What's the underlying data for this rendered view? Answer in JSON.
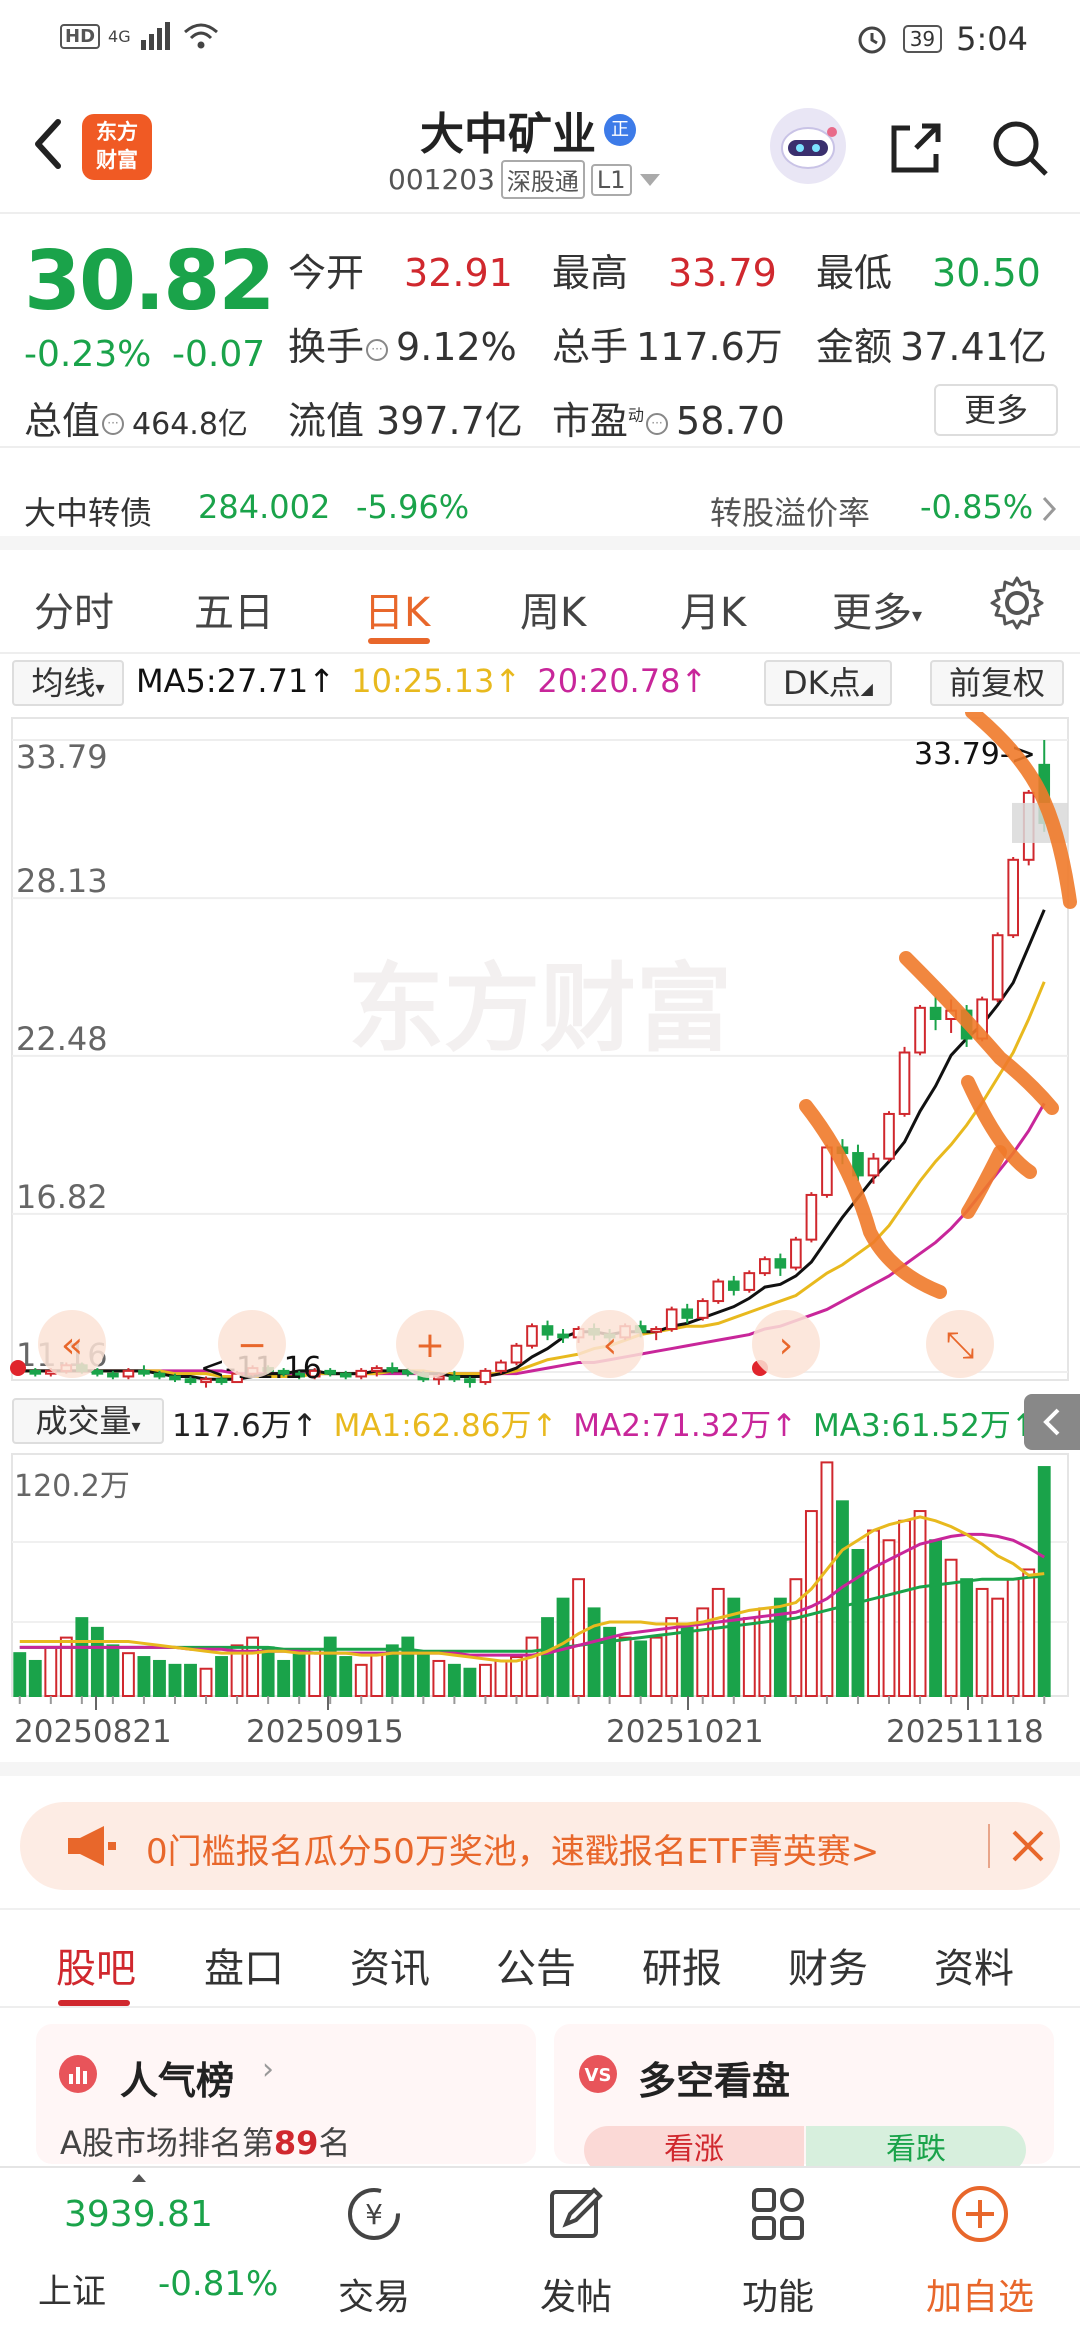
{
  "status": {
    "network": "4G",
    "hd": "HD",
    "battery": "39",
    "time": "5:04"
  },
  "header": {
    "logo_line1": "东方",
    "logo_line2": "财富",
    "stock_name": "大中矿业",
    "badge": "正",
    "code": "001203",
    "tag1": "深股通",
    "tag2": "L1"
  },
  "quote": {
    "price": "30.82",
    "change_pct": "-0.23%",
    "change": "-0.07",
    "open_label": "今开",
    "open": "32.91",
    "high_label": "最高",
    "high": "33.79",
    "low_label": "最低",
    "low": "30.50",
    "turnover_label": "换手",
    "turnover": "9.12%",
    "volume_label": "总手",
    "volume": "117.6万",
    "amount_label": "金额",
    "amount": "37.41亿",
    "mktcap_label": "总值",
    "mktcap": "464.8亿",
    "float_label": "流值",
    "float": "397.7亿",
    "pe_label": "市盈",
    "pe_sup": "动",
    "pe": "58.70",
    "more": "更多"
  },
  "bond": {
    "name": "大中转债",
    "price": "284.002",
    "pct": "-5.96%",
    "premium_label": "转股溢价率",
    "premium": "-0.85%"
  },
  "ktabs": [
    "分时",
    "五日",
    "日K",
    "周K",
    "月K",
    "更多"
  ],
  "ktabs_active": "日K",
  "chart_header": {
    "ma_btn": "均线",
    "ma5": "MA5:27.71↑",
    "ma10": "10:25.13↑",
    "ma20": "20:20.78↑",
    "dk_btn": "DK点",
    "fq_btn": "前复权"
  },
  "chart_data": {
    "type": "candlestick",
    "y_ticks": [
      "33.79",
      "28.13",
      "22.48",
      "16.82",
      "11.16"
    ],
    "ylim": [
      11.16,
      33.79
    ],
    "high_marker": "33.79->",
    "low_marker": "<-11.16",
    "watermark": "东方财富",
    "x_ticks": [
      "20250821",
      "20250915",
      "20251021",
      "20251118"
    ],
    "candles": [
      [
        11.3,
        11.4,
        11.1,
        11.2
      ],
      [
        11.2,
        11.3,
        11.0,
        11.1
      ],
      [
        11.1,
        11.3,
        11.0,
        11.2
      ],
      [
        11.2,
        11.5,
        11.1,
        11.4
      ],
      [
        11.4,
        11.5,
        11.1,
        11.2
      ],
      [
        11.2,
        11.3,
        11.0,
        11.1
      ],
      [
        11.1,
        11.2,
        10.9,
        11.0
      ],
      [
        11.0,
        11.3,
        10.9,
        11.2
      ],
      [
        11.2,
        11.4,
        11.0,
        11.1
      ],
      [
        11.1,
        11.2,
        10.9,
        11.0
      ],
      [
        11.0,
        11.1,
        10.8,
        10.9
      ],
      [
        10.9,
        11.0,
        10.7,
        10.8
      ],
      [
        10.8,
        11.0,
        10.6,
        10.9
      ],
      [
        10.9,
        11.0,
        10.7,
        10.8
      ],
      [
        10.8,
        11.2,
        10.8,
        11.1
      ],
      [
        11.1,
        11.4,
        11.0,
        11.3
      ],
      [
        11.3,
        11.4,
        11.1,
        11.2
      ],
      [
        11.2,
        11.3,
        11.0,
        11.1
      ],
      [
        11.1,
        11.2,
        10.9,
        11.0
      ],
      [
        11.0,
        11.3,
        10.9,
        11.2
      ],
      [
        11.2,
        11.3,
        11.0,
        11.1
      ],
      [
        11.1,
        11.2,
        10.9,
        11.0
      ],
      [
        11.0,
        11.3,
        10.9,
        11.2
      ],
      [
        11.2,
        11.4,
        11.0,
        11.3
      ],
      [
        11.3,
        11.5,
        11.1,
        11.2
      ],
      [
        11.2,
        11.3,
        11.0,
        11.1
      ],
      [
        11.1,
        11.2,
        10.8,
        10.9
      ],
      [
        10.9,
        11.1,
        10.7,
        11.0
      ],
      [
        11.0,
        11.2,
        10.8,
        10.9
      ],
      [
        10.9,
        11.0,
        10.6,
        10.8
      ],
      [
        10.8,
        11.3,
        10.7,
        11.2
      ],
      [
        11.2,
        11.6,
        11.1,
        11.5
      ],
      [
        11.5,
        12.2,
        11.4,
        12.1
      ],
      [
        12.1,
        12.9,
        12.0,
        12.8
      ],
      [
        12.8,
        13.0,
        12.3,
        12.5
      ],
      [
        12.5,
        12.7,
        12.2,
        12.4
      ],
      [
        12.4,
        12.8,
        12.2,
        12.7
      ],
      [
        12.7,
        12.9,
        12.3,
        12.5
      ],
      [
        12.5,
        12.7,
        12.2,
        12.4
      ],
      [
        12.4,
        12.9,
        12.3,
        12.8
      ],
      [
        12.8,
        13.0,
        12.4,
        12.6
      ],
      [
        12.6,
        12.8,
        12.3,
        12.7
      ],
      [
        12.7,
        13.5,
        12.6,
        13.4
      ],
      [
        13.4,
        13.6,
        12.9,
        13.1
      ],
      [
        13.1,
        13.8,
        13.0,
        13.7
      ],
      [
        13.7,
        14.5,
        13.6,
        14.4
      ],
      [
        14.4,
        14.6,
        13.9,
        14.1
      ],
      [
        14.1,
        14.8,
        14.0,
        14.7
      ],
      [
        14.7,
        15.3,
        14.6,
        15.2
      ],
      [
        15.2,
        15.4,
        14.6,
        14.9
      ],
      [
        14.9,
        16.0,
        14.8,
        15.9
      ],
      [
        15.9,
        17.6,
        15.8,
        17.5
      ],
      [
        17.5,
        19.3,
        17.4,
        19.2
      ],
      [
        19.2,
        19.5,
        18.6,
        19.0
      ],
      [
        19.0,
        19.3,
        18.0,
        18.2
      ],
      [
        18.2,
        19.0,
        17.9,
        18.8
      ],
      [
        18.8,
        20.5,
        18.7,
        20.4
      ],
      [
        20.4,
        22.8,
        20.3,
        22.6
      ],
      [
        22.6,
        24.3,
        22.5,
        24.2
      ],
      [
        24.2,
        24.6,
        23.4,
        23.8
      ],
      [
        23.8,
        24.5,
        23.3,
        24.1
      ],
      [
        24.1,
        24.3,
        22.8,
        23.1
      ],
      [
        23.1,
        24.6,
        23.0,
        24.5
      ],
      [
        24.5,
        26.9,
        24.4,
        26.8
      ],
      [
        26.8,
        29.6,
        26.7,
        29.5
      ],
      [
        29.5,
        32.0,
        29.3,
        31.9
      ],
      [
        32.9,
        33.79,
        30.5,
        30.82
      ]
    ],
    "ma5": [
      11.2,
      11.2,
      11.2,
      11.2,
      11.2,
      11.2,
      11.2,
      11.2,
      11.2,
      11.1,
      11.0,
      11.0,
      10.9,
      10.9,
      10.9,
      11.0,
      11.1,
      11.1,
      11.2,
      11.2,
      11.1,
      11.1,
      11.1,
      11.2,
      11.2,
      11.2,
      11.1,
      11.1,
      11.0,
      11.0,
      11.0,
      11.1,
      11.3,
      11.7,
      12.0,
      12.4,
      12.6,
      12.6,
      12.5,
      12.6,
      12.6,
      12.6,
      12.8,
      12.9,
      13.1,
      13.3,
      13.5,
      13.8,
      14.2,
      14.3,
      14.6,
      15.1,
      15.9,
      16.7,
      17.4,
      18.1,
      18.7,
      19.4,
      20.5,
      21.4,
      22.5,
      23.1,
      23.6,
      24.3,
      25.1,
      26.4,
      27.71
    ],
    "ma10": [
      11.2,
      11.2,
      11.2,
      11.2,
      11.2,
      11.2,
      11.2,
      11.2,
      11.2,
      11.2,
      11.1,
      11.1,
      11.1,
      11.0,
      11.0,
      11.0,
      11.0,
      11.0,
      11.0,
      11.1,
      11.1,
      11.1,
      11.1,
      11.1,
      11.2,
      11.2,
      11.2,
      11.1,
      11.1,
      11.1,
      11.1,
      11.1,
      11.2,
      11.4,
      11.6,
      11.7,
      11.8,
      12.0,
      12.1,
      12.3,
      12.5,
      12.6,
      12.7,
      12.8,
      12.8,
      12.9,
      13.1,
      13.3,
      13.5,
      13.7,
      13.9,
      14.3,
      14.7,
      15.0,
      15.4,
      15.8,
      16.4,
      17.2,
      18.0,
      18.7,
      19.3,
      20.0,
      20.8,
      21.7,
      22.6,
      23.8,
      25.13
    ],
    "ma20": [
      11.2,
      11.2,
      11.2,
      11.2,
      11.2,
      11.2,
      11.2,
      11.2,
      11.2,
      11.2,
      11.2,
      11.2,
      11.2,
      11.2,
      11.1,
      11.1,
      11.1,
      11.1,
      11.1,
      11.1,
      11.1,
      11.1,
      11.1,
      11.1,
      11.1,
      11.1,
      11.1,
      11.1,
      11.1,
      11.1,
      11.1,
      11.1,
      11.1,
      11.2,
      11.3,
      11.4,
      11.5,
      11.5,
      11.6,
      11.7,
      11.8,
      11.9,
      12.0,
      12.1,
      12.2,
      12.3,
      12.4,
      12.5,
      12.7,
      12.8,
      13.0,
      13.2,
      13.4,
      13.7,
      14.0,
      14.3,
      14.6,
      15.0,
      15.4,
      15.8,
      16.3,
      16.9,
      17.6,
      18.3,
      19.0,
      19.8,
      20.78
    ]
  },
  "volume_header": {
    "btn": "成交量",
    "vol": "117.6万↑",
    "ma1": "MA1:62.86万↑",
    "ma2": "MA2:71.32万↑",
    "ma3": "MA3:61.52万↑"
  },
  "volume_data": {
    "y_tick": "120.2万",
    "values": [
      22,
      18,
      25,
      30,
      40,
      35,
      26,
      22,
      20,
      18,
      16,
      16,
      14,
      20,
      26,
      30,
      25,
      18,
      22,
      24,
      30,
      20,
      16,
      22,
      26,
      30,
      22,
      18,
      16,
      14,
      16,
      18,
      20,
      30,
      40,
      50,
      60,
      45,
      35,
      30,
      28,
      30,
      40,
      35,
      45,
      55,
      50,
      40,
      45,
      50,
      60,
      95,
      120,
      100,
      75,
      85,
      80,
      90,
      95,
      80,
      70,
      60,
      55,
      50,
      60,
      65,
      117.6
    ],
    "ma1": [
      28,
      28,
      28,
      28,
      28,
      28,
      28,
      28,
      27,
      26,
      25,
      24,
      23,
      22,
      22,
      22,
      23,
      23,
      22,
      22,
      22,
      22,
      21,
      21,
      22,
      22,
      22,
      22,
      21,
      20,
      19,
      18,
      18,
      20,
      23,
      27,
      32,
      36,
      38,
      38,
      38,
      37,
      37,
      37,
      38,
      40,
      42,
      44,
      45,
      46,
      48,
      55,
      65,
      75,
      80,
      85,
      88,
      90,
      92,
      90,
      87,
      83,
      78,
      72,
      68,
      62,
      62.86
    ],
    "ma2": [
      25,
      25,
      25,
      25,
      25,
      25,
      25,
      25,
      25,
      25,
      25,
      24,
      24,
      24,
      23,
      23,
      23,
      23,
      23,
      22,
      22,
      22,
      22,
      22,
      22,
      22,
      22,
      22,
      22,
      21,
      21,
      21,
      21,
      21,
      22,
      24,
      26,
      28,
      30,
      32,
      33,
      34,
      35,
      36,
      37,
      38,
      39,
      40,
      41,
      42,
      43,
      46,
      50,
      56,
      61,
      66,
      70,
      74,
      78,
      80,
      82,
      83,
      83,
      82,
      80,
      76,
      71.32
    ],
    "ma3": [
      25,
      25,
      25,
      25,
      25,
      25,
      25,
      25,
      25,
      25,
      25,
      25,
      25,
      25,
      25,
      25,
      25,
      24,
      24,
      24,
      24,
      24,
      24,
      24,
      24,
      24,
      23,
      23,
      23,
      23,
      23,
      23,
      23,
      23,
      24,
      25,
      26,
      27,
      28,
      29,
      30,
      31,
      32,
      33,
      34,
      35,
      36,
      37,
      38,
      39,
      40,
      42,
      44,
      46,
      48,
      50,
      52,
      54,
      56,
      57,
      58,
      59,
      60,
      60,
      60,
      61,
      61.52
    ]
  },
  "promo": "0门槛报名瓜分50万奖池，速戳报名ETF菁英赛>",
  "btabs": [
    "股吧",
    "盘口",
    "资讯",
    "公告",
    "研报",
    "财务",
    "资料"
  ],
  "btabs_active": "股吧",
  "cards": {
    "left_title": "人气榜",
    "left_sub_pre": "A股市场排名第",
    "left_rank": "89",
    "left_sub_post": "名",
    "right_title": "多空看盘",
    "up": "看涨",
    "down": "看跌"
  },
  "bottom_nav": {
    "index_value": "3939.81",
    "index_name": "上证",
    "index_pct": "-0.81%",
    "trade": "交易",
    "post": "发帖",
    "func": "功能",
    "add": "加自选"
  },
  "colors": {
    "up": "#d0282e",
    "down": "#1aa34a",
    "accent": "#e8672b",
    "ma5": "#111111",
    "ma10": "#e8b91e",
    "ma20": "#c8269a"
  }
}
